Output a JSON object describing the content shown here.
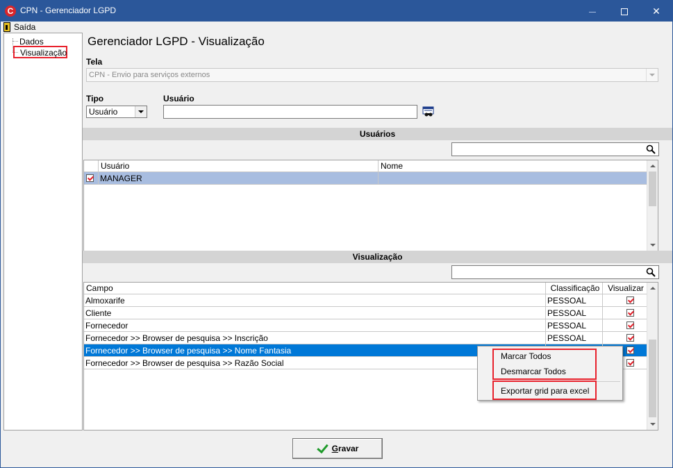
{
  "window": {
    "title": "CPN - Gerenciador LGPD",
    "icon": "app-logo-icon",
    "minimize": "",
    "maximize": "",
    "close": "✕"
  },
  "menu": {
    "exit_label": "Saída"
  },
  "tree": {
    "items": [
      "Dados",
      "Visualização"
    ]
  },
  "page": {
    "title": "Gerenciador LGPD - Visualização"
  },
  "form": {
    "tela_label": "Tela",
    "tela_value": "CPN - Envio para serviços externos",
    "tipo_label": "Tipo",
    "tipo_value": "Usuário",
    "usuario_label": "Usuário",
    "usuario_value": ""
  },
  "users_section": {
    "title": "Usuários",
    "search_value": "",
    "columns": [
      "Usuário",
      "Nome"
    ],
    "rows": [
      {
        "checked": true,
        "usuario": "MANAGER",
        "nome": ""
      }
    ]
  },
  "vis_section": {
    "title": "Visualização",
    "search_value": "",
    "columns": [
      "Campo",
      "Classificação",
      "Visualizar"
    ],
    "rows": [
      {
        "campo": "Almoxarife",
        "classificacao": "PESSOAL",
        "visualizar": true
      },
      {
        "campo": "Cliente",
        "classificacao": "PESSOAL",
        "visualizar": true
      },
      {
        "campo": "Fornecedor",
        "classificacao": "PESSOAL",
        "visualizar": true
      },
      {
        "campo": "Fornecedor >> Browser de pesquisa >> Inscrição",
        "classificacao": "PESSOAL",
        "visualizar": true
      },
      {
        "campo": "Fornecedor >> Browser de pesquisa >> Nome Fantasia",
        "classificacao": "",
        "visualizar": true
      },
      {
        "campo": "Fornecedor >> Browser de pesquisa >> Razão Social",
        "classificacao": "",
        "visualizar": true
      }
    ]
  },
  "context_menu": {
    "items": [
      "Marcar Todos",
      "Desmarcar Todos",
      "Exportar grid para excel"
    ]
  },
  "footer": {
    "save_label_first": "G",
    "save_label_rest": "ravar"
  },
  "colors": {
    "titlebar": "#2b579a",
    "highlight": "#0078d7",
    "selected": "#a8bde0",
    "annotation_red": "#e8212c"
  }
}
